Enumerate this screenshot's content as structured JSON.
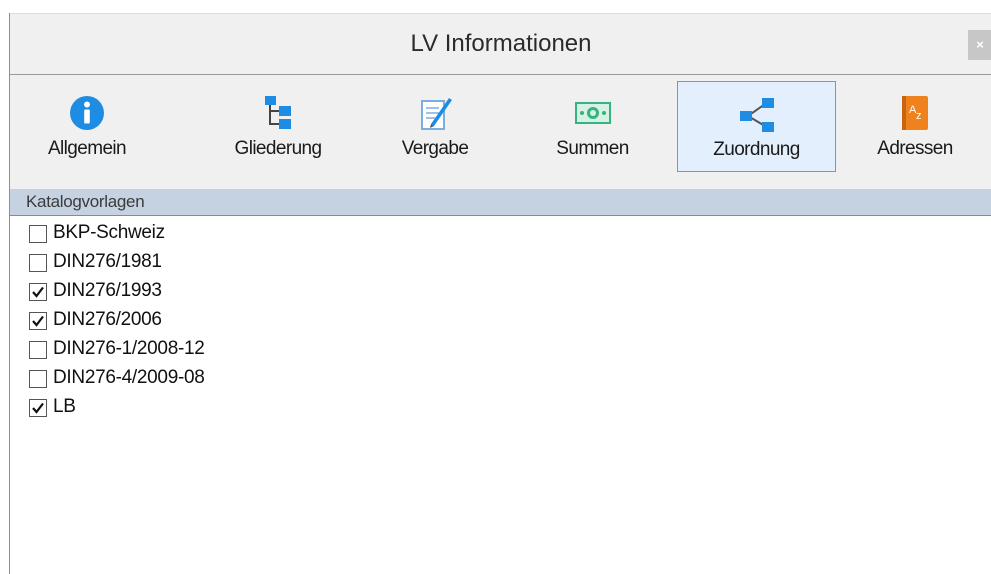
{
  "window": {
    "title": "LV Informationen",
    "close_label": "×"
  },
  "toolbar": {
    "items": [
      {
        "label": "Allgemein",
        "icon": "info-icon",
        "active": false
      },
      {
        "label": "Gliederung",
        "icon": "hierarchy-icon",
        "active": false
      },
      {
        "label": "Vergabe",
        "icon": "document-pen-icon",
        "active": false
      },
      {
        "label": "Summen",
        "icon": "money-icon",
        "active": false
      },
      {
        "label": "Zuordnung",
        "icon": "share-icon",
        "active": true
      },
      {
        "label": "Adressen",
        "icon": "address-book-icon",
        "active": false
      }
    ]
  },
  "section": {
    "title": "Katalogvorlagen"
  },
  "catalogs": [
    {
      "label": "BKP-Schweiz",
      "checked": false
    },
    {
      "label": "DIN276/1981",
      "checked": false
    },
    {
      "label": "DIN276/1993",
      "checked": true
    },
    {
      "label": "DIN276/2006",
      "checked": true
    },
    {
      "label": "DIN276-1/2008-12",
      "checked": false
    },
    {
      "label": "DIN276-4/2009-08",
      "checked": false
    },
    {
      "label": "LB",
      "checked": true
    }
  ],
  "colors": {
    "accent": "#1e8ce3",
    "active_bg": "#e3effc",
    "active_border": "#5aa0e8",
    "header_bg": "#c4d2e1",
    "address_orange": "#f0821e",
    "money_green": "#36b37e"
  }
}
